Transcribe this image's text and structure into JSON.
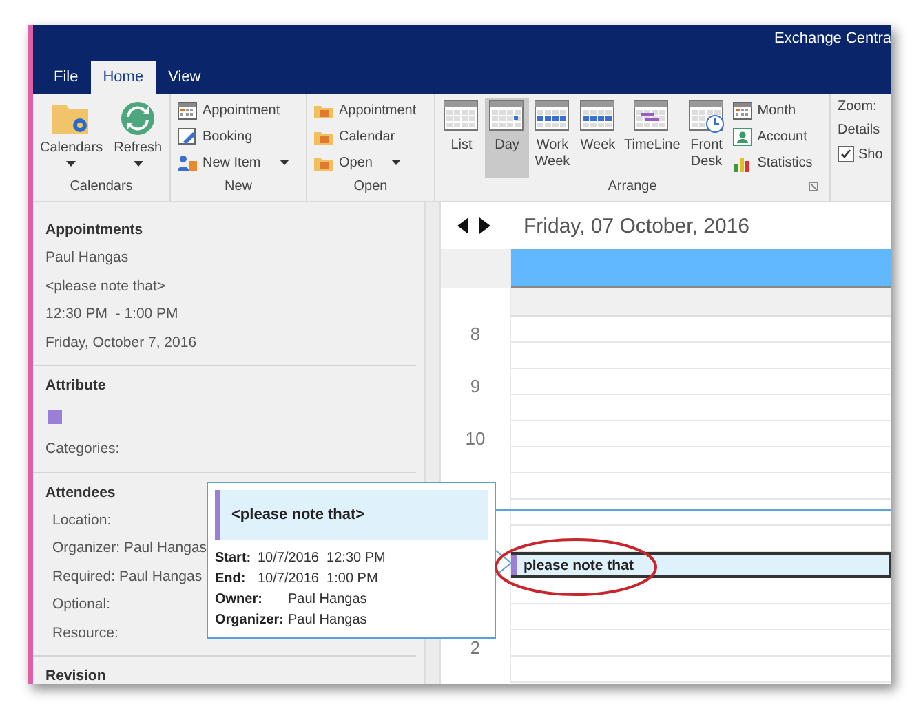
{
  "window": {
    "title": "Exchange Centra"
  },
  "tabs": [
    {
      "label": "File",
      "selected": false
    },
    {
      "label": "Home",
      "selected": true
    },
    {
      "label": "View",
      "selected": false
    }
  ],
  "ribbon": {
    "groups": [
      {
        "label": "Calendars",
        "kind": "large",
        "items": [
          {
            "label": "Calendars",
            "dropdown": true
          },
          {
            "label": "Refresh",
            "dropdown": true
          }
        ]
      },
      {
        "label": "New",
        "kind": "list",
        "items": [
          {
            "label": "Appointment",
            "dropdown": false
          },
          {
            "label": "Booking",
            "dropdown": false
          },
          {
            "label": "New Item",
            "dropdown": true
          }
        ]
      },
      {
        "label": "Open",
        "kind": "list",
        "items": [
          {
            "label": "Appointment",
            "dropdown": false
          },
          {
            "label": "Calendar",
            "dropdown": false
          },
          {
            "label": "Open",
            "dropdown": true
          }
        ]
      },
      {
        "label": "Arrange",
        "kind": "views",
        "items": [
          {
            "label": "List",
            "selected": false
          },
          {
            "label": "Day",
            "selected": true
          },
          {
            "label": "Work Week",
            "selected": false
          },
          {
            "label": "Week",
            "selected": false
          },
          {
            "label": "TimeLine",
            "selected": false
          },
          {
            "label": "Front Desk",
            "selected": false
          }
        ],
        "extras": [
          {
            "label": "Month"
          },
          {
            "label": "Account"
          },
          {
            "label": "Statistics"
          }
        ]
      }
    ],
    "options": [
      {
        "label": "Zoom:",
        "kind": "text"
      },
      {
        "label": "Details",
        "kind": "text"
      },
      {
        "label": "Sho",
        "kind": "checkbox",
        "checked": true
      }
    ]
  },
  "details": {
    "sections": [
      {
        "heading": "Appointments",
        "kind": "lines",
        "lines": [
          "Paul Hangas",
          "<please note that>",
          "12:30 PM  - 1:00 PM",
          "Friday, October 7, 2016"
        ]
      },
      {
        "heading": "Attribute",
        "kind": "attribute",
        "color": "#9b7fd6",
        "lines": [
          "Categories:"
        ]
      },
      {
        "heading": "Attendees",
        "kind": "indented",
        "lines": [
          "Location:",
          "Organizer: Paul Hangas",
          "Required: Paul Hangas",
          "Optional:",
          "Resource:"
        ]
      },
      {
        "heading": "Revision",
        "kind": "heading"
      }
    ]
  },
  "calendar": {
    "date": "Friday, 07 October, 2016",
    "hour_labels": [
      "8",
      "9",
      "10",
      "2"
    ],
    "event": {
      "title": "please note that",
      "color": "#9b7fd6"
    },
    "tooltip": {
      "title": "<please note that>",
      "rows": [
        {
          "label": "Start:",
          "value": "10/7/2016  12:30 PM"
        },
        {
          "label": "End:",
          "value": "10/7/2016  1:00 PM"
        },
        {
          "label": "Owner:",
          "value": "Paul Hangas"
        },
        {
          "label": "Organizer:",
          "value": "Paul Hangas"
        }
      ]
    }
  }
}
